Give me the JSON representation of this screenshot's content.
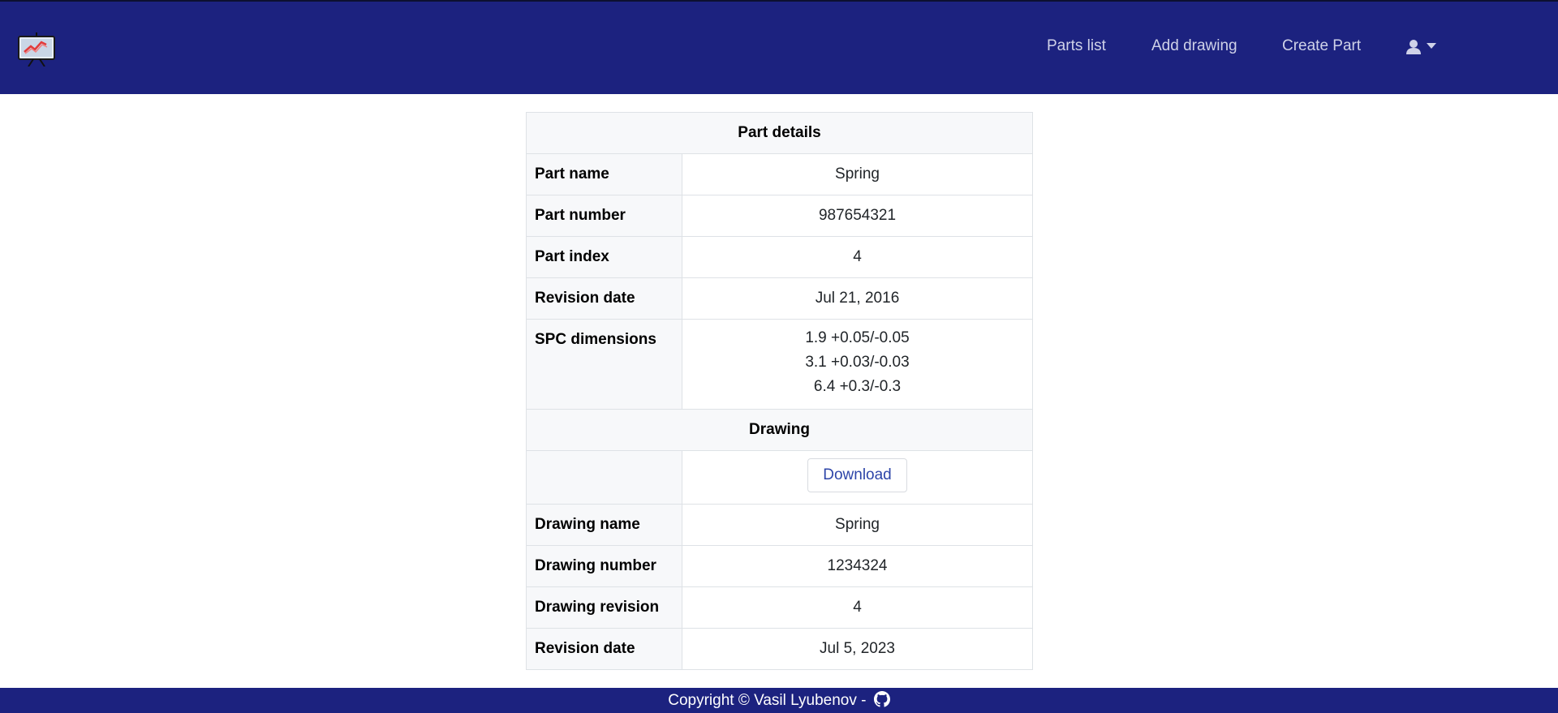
{
  "nav": {
    "logo_icon": "presentation-chart-icon",
    "links": [
      "Parts list",
      "Add drawing",
      "Create Part"
    ],
    "user_icon": "user-icon"
  },
  "part_details": {
    "header": "Part details",
    "rows": [
      {
        "label": "Part name",
        "value": "Spring"
      },
      {
        "label": "Part number",
        "value": "987654321"
      },
      {
        "label": "Part index",
        "value": "4"
      },
      {
        "label": "Revision date",
        "value": "Jul 21, 2016"
      }
    ],
    "spc_label": "SPC dimensions",
    "spc_values": [
      "1.9 +0.05/-0.05",
      "3.1 +0.03/-0.03",
      "6.4 +0.3/-0.3"
    ]
  },
  "drawing": {
    "header": "Drawing",
    "download_label": "Download",
    "rows": [
      {
        "label": "Drawing name",
        "value": "Spring"
      },
      {
        "label": "Drawing number",
        "value": "1234324"
      },
      {
        "label": "Drawing revision",
        "value": "4"
      },
      {
        "label": "Revision date",
        "value": "Jul 5, 2023"
      }
    ]
  },
  "footer": {
    "text": "Copyright © Vasil Lyubenov -",
    "icon": "github-icon"
  },
  "colors": {
    "navbar": "#1c227f",
    "nav_link": "#cfd2e8",
    "table_header_bg": "#f7f8fa",
    "button_text": "#2d45a8"
  }
}
